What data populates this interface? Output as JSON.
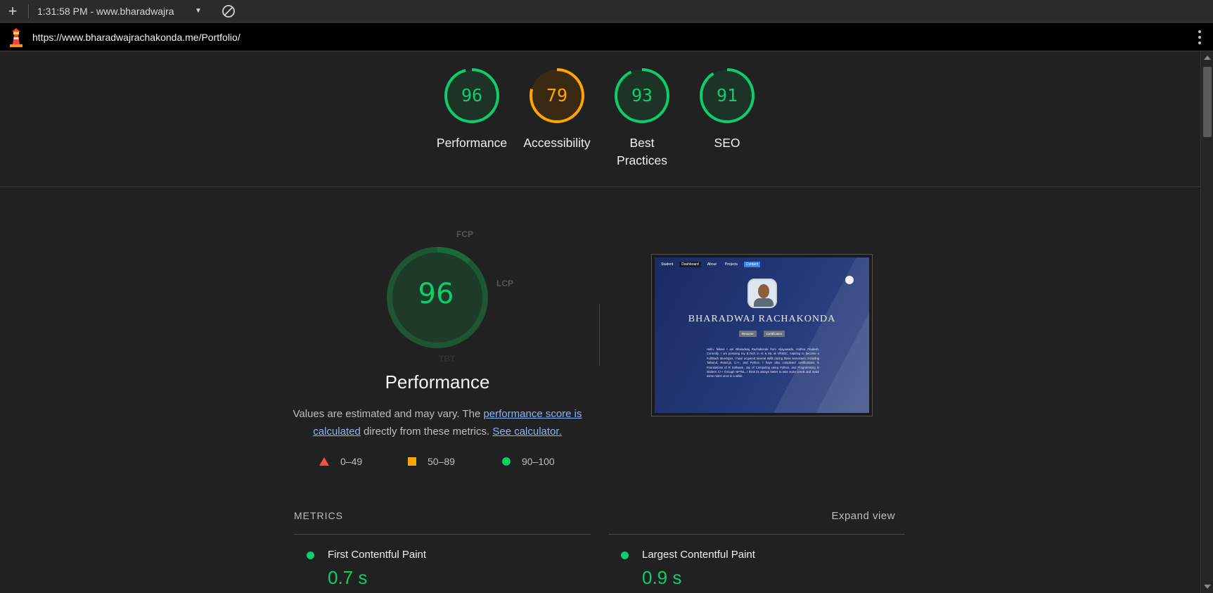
{
  "toolbar": {
    "add_icon": "plus-icon",
    "report_label": "1:31:58 PM - www.bharadwajra",
    "clear_icon": "block-icon"
  },
  "urlbar": {
    "url": "https://www.bharadwajrachakonda.me/Portfolio/",
    "logo_icon": "lighthouse-icon",
    "menu_icon": "kebab-menu-icon"
  },
  "colors": {
    "pass": "#0cce6b",
    "average": "#ffa400",
    "fail": "#ff4e42"
  },
  "scores": [
    {
      "label": "Performance",
      "value": "96",
      "score": 96,
      "status": "pass"
    },
    {
      "label": "Accessibility",
      "value": "79",
      "score": 79,
      "status": "average"
    },
    {
      "label": "Best Practices",
      "value": "93",
      "score": 93,
      "status": "pass"
    },
    {
      "label": "SEO",
      "value": "91",
      "score": 91,
      "status": "pass"
    }
  ],
  "performance": {
    "score": "96",
    "title": "Performance",
    "desc_pre": "Values are estimated and may vary. The ",
    "desc_link1": "performance score is calculated",
    "desc_mid": " directly from these metrics. ",
    "desc_link2": "See calculator.",
    "metric_labels": {
      "fcp": "FCP",
      "lcp": "LCP",
      "tbt": "TBT"
    }
  },
  "legend": [
    {
      "range": "0–49",
      "shape": "triangle",
      "color": "#ff4e42"
    },
    {
      "range": "50–89",
      "shape": "square",
      "color": "#ffa400"
    },
    {
      "range": "90–100",
      "shape": "circle",
      "color": "#0cce6b"
    }
  ],
  "preview": {
    "nav": [
      "Student",
      "Dashboard",
      "About",
      "Projects",
      "Contact"
    ],
    "name": "BHARADWAJ RACHAKONDA",
    "buttons": [
      "Resume",
      "Certificates"
    ],
    "paragraph": "Hello, fellow! I am Bharadwaj Rachakonda from Vijayawada, Andhra Pradesh. Currently, I am pursuing my B.Tech in AI & ML at VRSEC. Aspiring to become a FullStack developer, I have acquired several skills during these semesters, including Tailwind, React.js, C++, and Python. I have also completed certifications in Foundations of R Software, Joy of Computing using Python, and Programming in Modern C++ through NPTEL. I think its always better to take some break and make some notes once in a while."
  },
  "metrics": {
    "title": "METRICS",
    "expand": "Expand view",
    "items": [
      {
        "name": "First Contentful Paint",
        "value": "0.7 s",
        "status": "pass"
      },
      {
        "name": "Largest Contentful Paint",
        "value": "0.9 s",
        "status": "pass"
      }
    ]
  }
}
